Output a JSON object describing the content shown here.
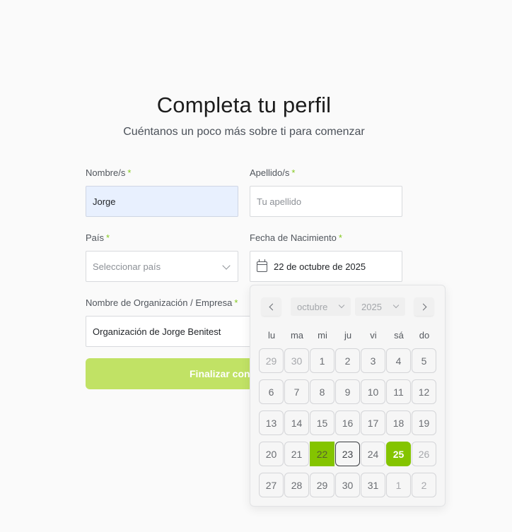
{
  "header": {
    "title": "Completa tu perfil",
    "subtitle": "Cuéntanos un poco más sobre ti para comenzar"
  },
  "form": {
    "first_name": {
      "label": "Nombre/s",
      "value": "Jorge"
    },
    "last_name": {
      "label": "Apellido/s",
      "placeholder": "Tu apellido"
    },
    "country": {
      "label": "País",
      "placeholder": "Seleccionar país"
    },
    "birthdate": {
      "label": "Fecha de Nacimiento",
      "value": "22 de octubre de 2025"
    },
    "organization": {
      "label": "Nombre de Organización / Empresa",
      "value": "Organización de Jorge Benitest"
    },
    "required_mark": "*",
    "submit_label": "Finalizar con"
  },
  "calendar": {
    "month": "octubre",
    "year": "2025",
    "weekdays": [
      "lu",
      "ma",
      "mi",
      "ju",
      "vi",
      "sá",
      "do"
    ],
    "weeks": [
      [
        "29",
        "30",
        "1",
        "2",
        "3",
        "4",
        "5"
      ],
      [
        "6",
        "7",
        "8",
        "9",
        "10",
        "11",
        "12"
      ],
      [
        "13",
        "14",
        "15",
        "16",
        "17",
        "18",
        "19"
      ],
      [
        "20",
        "21",
        "22",
        "23",
        "24",
        "25",
        "26"
      ],
      [
        "27",
        "28",
        "29",
        "30",
        "31",
        "1",
        "2"
      ]
    ],
    "colors": {
      "accent": "#84c400",
      "button": "#c1e265"
    }
  }
}
